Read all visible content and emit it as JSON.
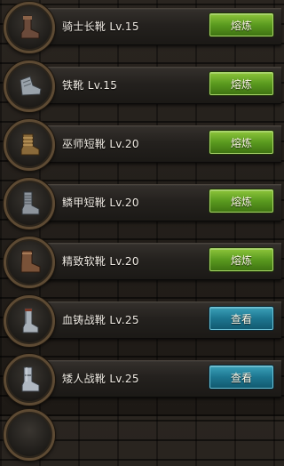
{
  "items": [
    {
      "name": "骑士长靴 Lv.15",
      "button": "熔炼",
      "button_style": "green",
      "icon": "knight-boots-icon",
      "icon_color": "#6b4a3a"
    },
    {
      "name": "铁靴 Lv.15",
      "button": "熔炼",
      "button_style": "green",
      "icon": "iron-boots-icon",
      "icon_color": "#9aa3ab"
    },
    {
      "name": "巫师短靴 Lv.20",
      "button": "熔炼",
      "button_style": "green",
      "icon": "wizard-boots-icon",
      "icon_color": "#8a6a3a"
    },
    {
      "name": "鳞甲短靴 Lv.20",
      "button": "熔炼",
      "button_style": "green",
      "icon": "scale-boots-icon",
      "icon_color": "#8d949c"
    },
    {
      "name": "精致软靴 Lv.20",
      "button": "熔炼",
      "button_style": "green",
      "icon": "fine-soft-boots-icon",
      "icon_color": "#7a5238"
    },
    {
      "name": "血铸战靴 Lv.25",
      "button": "查看",
      "button_style": "blue",
      "icon": "bloodforged-boots-icon",
      "icon_color": "#a8b0b8"
    },
    {
      "name": "矮人战靴 Lv.25",
      "button": "查看",
      "button_style": "blue",
      "icon": "dwarf-boots-icon",
      "icon_color": "#b0b8c2"
    }
  ],
  "colors": {
    "smelt_button": "#5a9a1f",
    "view_button": "#1d7690",
    "frame_ring": "#5d4a33"
  }
}
